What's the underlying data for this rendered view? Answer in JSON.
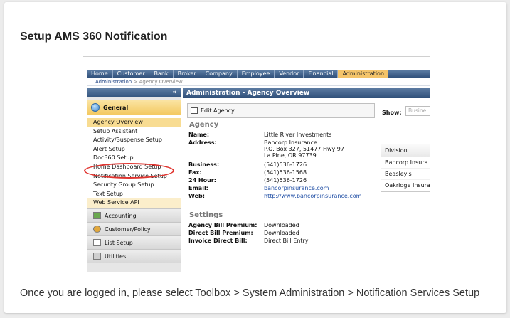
{
  "card": {
    "title": "Setup AMS 360 Notification",
    "caption": "Once you are logged in, please select Toolbox > System Administration > Notification Services Setup"
  },
  "nav": [
    "Home",
    "Customer",
    "Bank",
    "Broker",
    "Company",
    "Employee",
    "Vendor",
    "Financial",
    "Administration"
  ],
  "breadcrumb": {
    "parent": "Administration",
    "sep": ">",
    "current": "Agency Overview"
  },
  "sidebar": {
    "collapse": "«",
    "general_label": "General",
    "items": [
      "Agency Overview",
      "Setup Assistant",
      "Activity/Suspense Setup",
      "Alert Setup",
      "Doc360 Setup",
      "Home Dashboard Setup",
      "Notification Service Setup",
      "Security Group Setup",
      "Text Setup",
      "Web Service API"
    ],
    "sections": [
      "Accounting",
      "Customer/Policy",
      "List Setup",
      "Utilities"
    ]
  },
  "main": {
    "title": "Administration - Agency Overview",
    "edit_button": "Edit Agency",
    "show_label": "Show:",
    "show_value": "Busine",
    "agency_heading": "Agency",
    "agency": {
      "name_label": "Name:",
      "name": "Little River Investments",
      "address_label": "Address:",
      "address1": "Bancorp Insurance",
      "address2": "P.O. Box 327, 51477 Hwy 97",
      "address3": "La Pine, OR 97739",
      "business_label": "Business:",
      "business": "(541)536-1726",
      "fax_label": "Fax:",
      "fax": "(541)536-1568",
      "hour24_label": "24 Hour:",
      "hour24": "(541)536-1726",
      "email_label": "Email:",
      "email": "bancorpinsurance.com",
      "web_label": "Web:",
      "web": "http://www.bancorpinsurance.com"
    },
    "settings_heading": "Settings",
    "settings": {
      "agency_bill_label": "Agency Bill Premium:",
      "agency_bill": "Downloaded",
      "direct_bill_label": "Direct Bill Premium:",
      "direct_bill": "Downloaded",
      "invoice_label": "Invoice Direct Bill:",
      "invoice": "Direct Bill Entry"
    },
    "grid": {
      "header": "Division",
      "rows": [
        "Bancorp Insura",
        "Beasley's",
        "Oakridge Insura"
      ]
    }
  },
  "colors": {
    "nav_blue": "#2d4e78",
    "active_tab": "#f4c46a",
    "highlight_oval": "#e0342f",
    "link": "#1f4ea5"
  }
}
